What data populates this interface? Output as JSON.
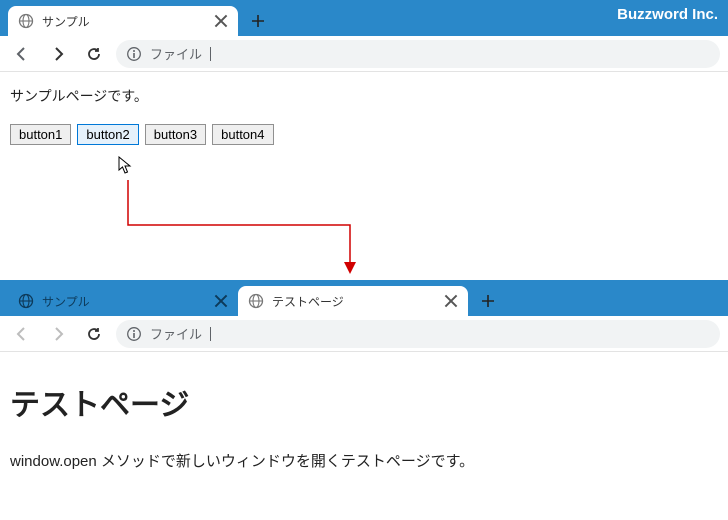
{
  "watermark": "Buzzword Inc.",
  "top": {
    "tabs": [
      {
        "title": "サンプル",
        "active": true
      }
    ],
    "addressLabel": "ファイル",
    "page": {
      "intro": "サンプルページです。",
      "buttons": [
        "button1",
        "button2",
        "button3",
        "button4"
      ]
    }
  },
  "bottom": {
    "tabs": [
      {
        "title": "サンプル",
        "active": false
      },
      {
        "title": "テストページ",
        "active": true
      }
    ],
    "addressLabel": "ファイル",
    "page": {
      "heading": "テストページ",
      "body": "window.open メソッドで新しいウィンドウを開くテストページです。"
    }
  }
}
